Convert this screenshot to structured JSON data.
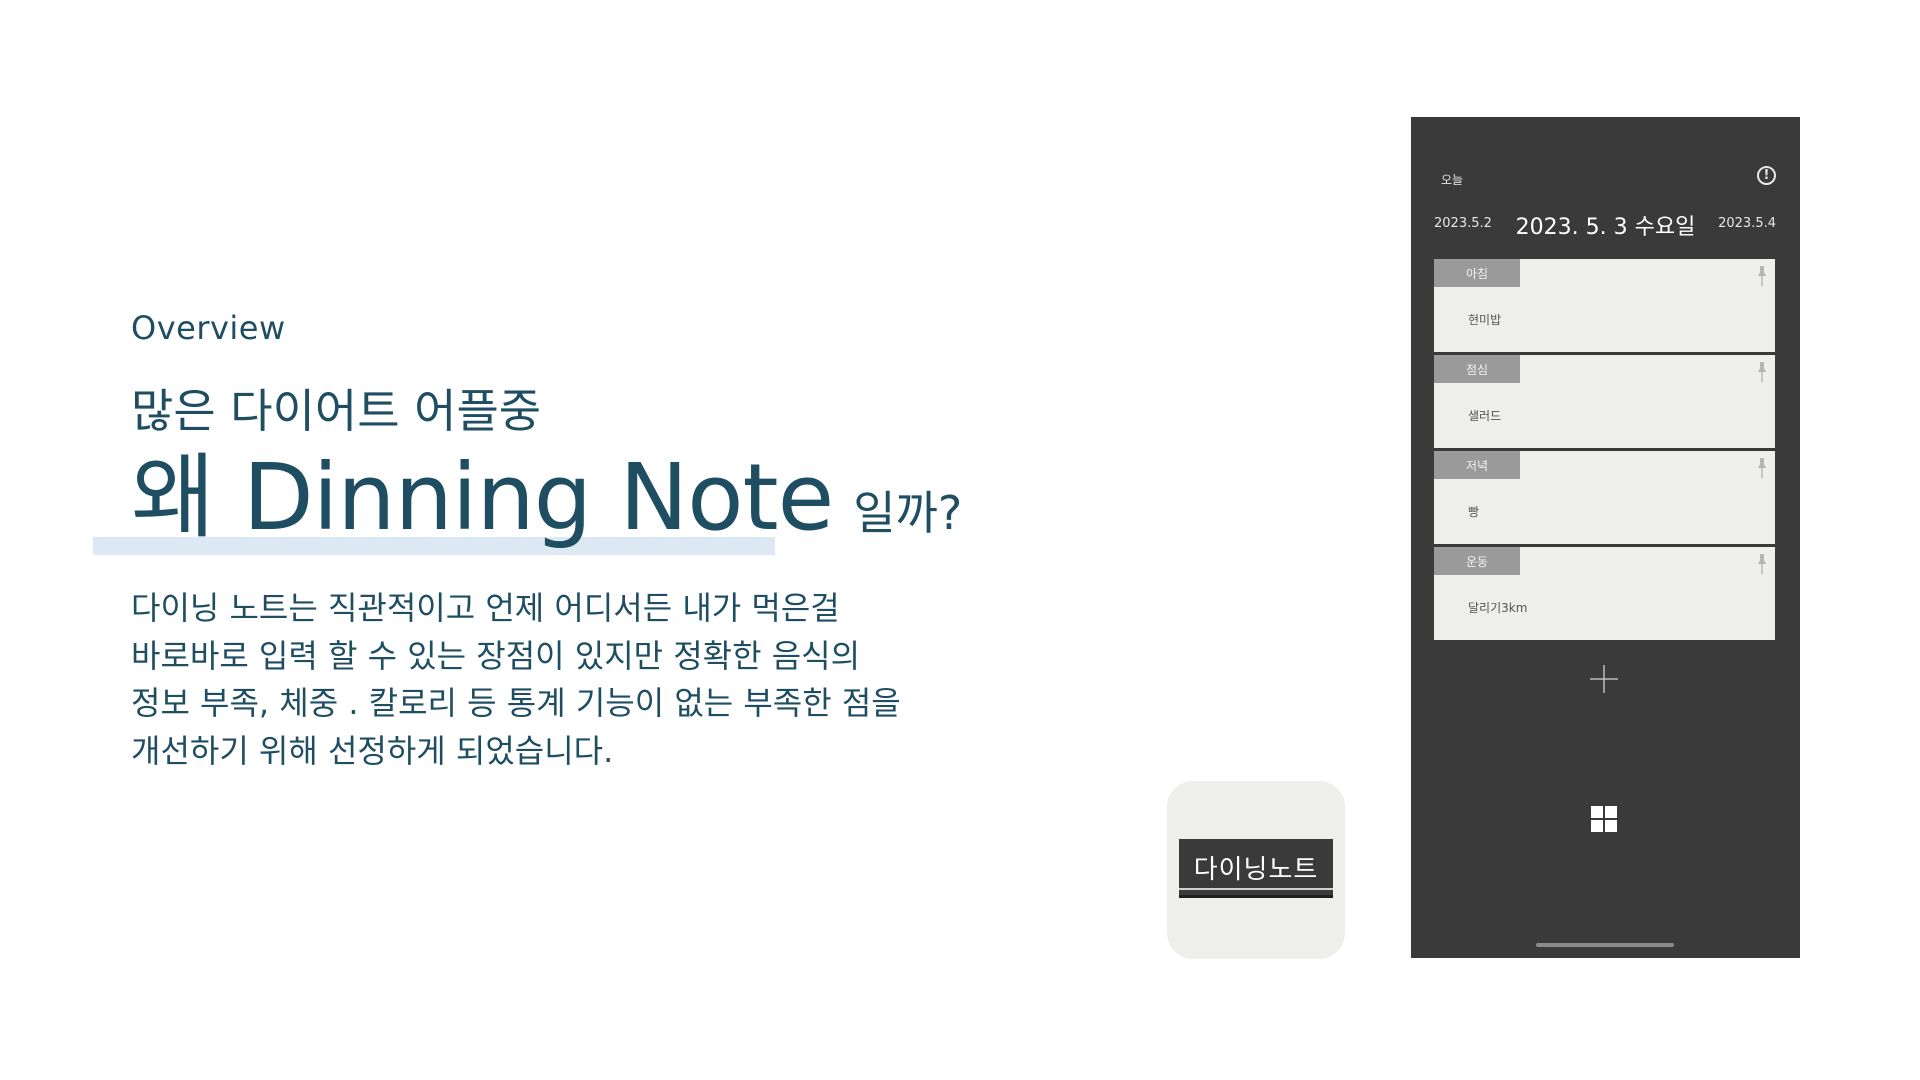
{
  "left": {
    "overview": "Overview",
    "subtitle": "많은 다이어트 어플중",
    "headline": "왜 Dinning Note",
    "headline_suffix": "일까?",
    "description": "다이닝 노트는 직관적이고 언제 어디서든  내가 먹은걸\n바로바로 입력 할 수 있는 장점이 있지만 정확한 음식의\n정보 부족, 체중 . 칼로리 등 통계 기능이 없는 부족한 점을\n개선하기 위해 선정하게 되었습니다."
  },
  "app_icon": {
    "label": "다이닝노트"
  },
  "phone": {
    "today_label": "오늘",
    "info_icon": "info-circle-icon",
    "info_glyph": "!",
    "prev_date": "2023.5.2",
    "current_date": "2023. 5. 3 수요일",
    "next_date": "2023.5.4",
    "meals": [
      {
        "tag": "아침",
        "item": "현미밥"
      },
      {
        "tag": "점심",
        "item": "샐러드"
      },
      {
        "tag": "저녁",
        "item": "빵"
      },
      {
        "tag": "운동",
        "item": "달리기3km"
      }
    ],
    "add_icon": "plus-icon",
    "menu_icon": "grid-icon"
  },
  "colors": {
    "text_primary": "#1f4e62",
    "highlight": "#dce9f5",
    "phone_bg": "#3a3a3a",
    "card_bg": "#eeeeea",
    "tag_bg": "#9a9a9a"
  }
}
